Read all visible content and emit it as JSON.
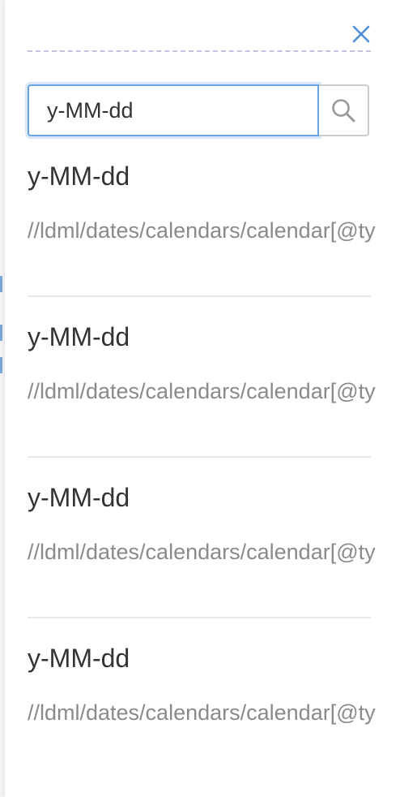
{
  "panel": {
    "close_icon": "close-icon",
    "accent_color": "#4a90d9",
    "divider_color": "#c7c0df"
  },
  "search": {
    "value": "y-MM-dd",
    "icon": "search-icon"
  },
  "results": [
    {
      "title": "y-MM-dd",
      "path": "//ldml/dates/calendars/calendar[@ty"
    },
    {
      "title": "y-MM-dd",
      "path": "//ldml/dates/calendars/calendar[@ty"
    },
    {
      "title": "y-MM-dd",
      "path": "//ldml/dates/calendars/calendar[@ty"
    },
    {
      "title": "y-MM-dd",
      "path": "//ldml/dates/calendars/calendar[@ty"
    }
  ]
}
